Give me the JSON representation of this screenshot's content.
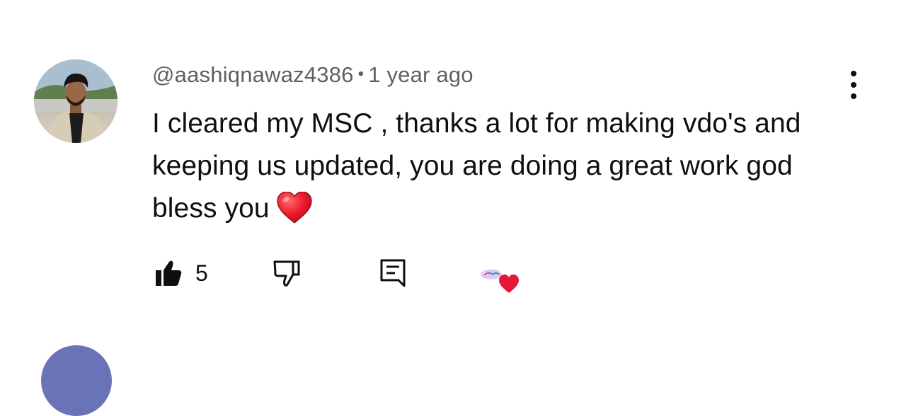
{
  "comment": {
    "author": "@aashiqnawaz4386",
    "separator": "•",
    "timestamp": "1 year ago",
    "text": "I cleared my MSC , thanks a lot for making vdo's and keeping us updated, you are doing a great work god bless you",
    "emoji": "red-heart-emoji",
    "like_count": "5",
    "actions": {
      "like_icon": "thumbs-up-filled-icon",
      "dislike_icon": "thumbs-down-icon",
      "reply_icon": "reply-comment-icon",
      "creator_heart": "creator-heart-icon",
      "menu_icon": "more-vertical-icon"
    }
  },
  "colors": {
    "text_primary": "#0f0f0f",
    "text_secondary": "#606060",
    "heart_red": "#e4163a",
    "next_avatar": "#6a72b8"
  }
}
